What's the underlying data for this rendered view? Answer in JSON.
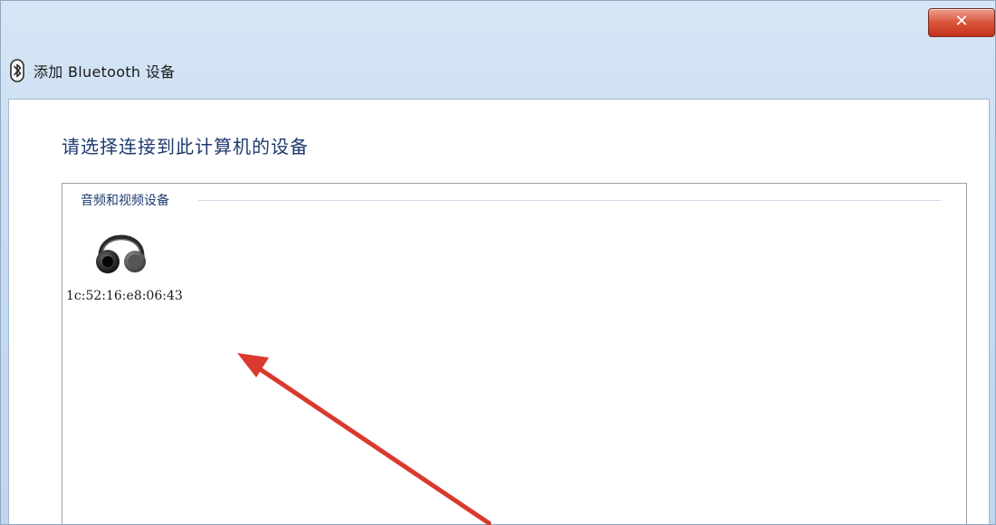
{
  "window": {
    "title": "添加 Bluetooth 设备",
    "close_glyph": "✕",
    "icon": "bluetooth-icon"
  },
  "content": {
    "heading": "请选择连接到此计算机的设备",
    "group_header": "音频和视频设备",
    "devices": [
      {
        "label": "1c:52:16:e8:06:43",
        "icon": "headphones-icon"
      }
    ]
  },
  "annotation": {
    "color": "#d93a2e",
    "icon": "red-arrow-annotation"
  }
}
